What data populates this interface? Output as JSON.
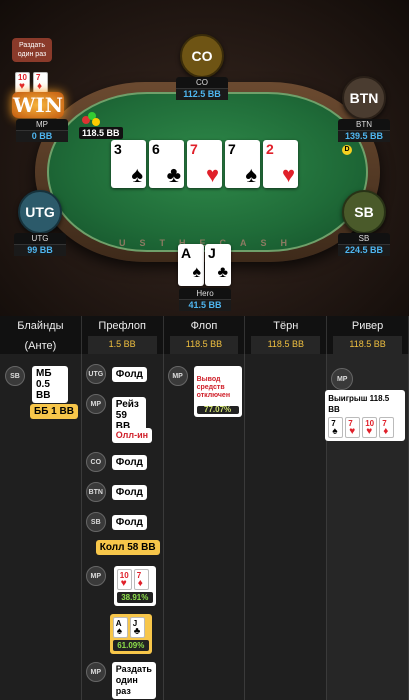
{
  "deal_tooltip": "Раздать один раз",
  "win_label": "WIN",
  "table_text": "USTHECASH",
  "pot": "118.5 BB",
  "dealer_button": "D",
  "seats": {
    "co": {
      "label": "CO",
      "name": "CO",
      "stack": "112.5 BB"
    },
    "btn": {
      "label": "BTN",
      "name": "BTN",
      "stack": "139.5 BB"
    },
    "mp": {
      "name": "MP",
      "stack": "0 BB",
      "c1": "10",
      "c2": "7"
    },
    "utg": {
      "label": "UTG",
      "name": "UTG",
      "stack": "99 BB"
    },
    "sb": {
      "label": "SB",
      "name": "SB",
      "stack": "224.5 BB"
    },
    "hero": {
      "name": "Hero",
      "stack": "41.5 BB",
      "c1": "A",
      "c2": "J"
    }
  },
  "board": [
    {
      "rank": "3",
      "suit": "♠",
      "color": "black"
    },
    {
      "rank": "6",
      "suit": "♣",
      "color": "black"
    },
    {
      "rank": "7",
      "suit": "♥",
      "color": "red"
    },
    {
      "rank": "7",
      "suit": "♠",
      "color": "black"
    },
    {
      "rank": "2",
      "suit": "♥",
      "color": "red"
    }
  ],
  "streets": [
    {
      "name": "Блайнды (Анте)",
      "pot": ""
    },
    {
      "name": "Префлоп",
      "pot": "1.5 BB"
    },
    {
      "name": "Флоп",
      "pot": "118.5 BB"
    },
    {
      "name": "Тёрн",
      "pot": "118.5 BB"
    },
    {
      "name": "Ривер",
      "pot": "118.5 BB"
    }
  ],
  "actions": {
    "sb_blind": {
      "badge": "SB",
      "text": "МБ 0.5 BB"
    },
    "bb_blind": {
      "text": "ББ 1 BB"
    },
    "utg_fold": {
      "badge": "UTG",
      "text": "Фолд"
    },
    "mp_raise": {
      "badge": "MP",
      "text": "Рейз 59 BB",
      "tag": "Олл-ин"
    },
    "co_fold": {
      "badge": "CO",
      "text": "Фолд"
    },
    "btn_fold": {
      "badge": "BTN",
      "text": "Фолд"
    },
    "sb_fold": {
      "badge": "SB",
      "text": "Фолд"
    },
    "hero_call": {
      "text": "Колл 58 BB"
    },
    "mp_show": {
      "badge": "MP",
      "c1": "10",
      "c2": "7",
      "pct": "38.91%"
    },
    "hero_show": {
      "c1": "A",
      "c2": "J",
      "pct": "61.09%"
    },
    "mp_deal": {
      "badge": "MP",
      "text": "Раздать один раз"
    },
    "flop_mp": {
      "badge": "MP",
      "text": "Вывод средств отключен",
      "pct": "77.07%"
    },
    "river_mp": {
      "badge": "MP",
      "text": "Выигрыш 118.5 BB",
      "cards": [
        "7",
        "7",
        "10",
        "7",
        "2"
      ]
    }
  }
}
